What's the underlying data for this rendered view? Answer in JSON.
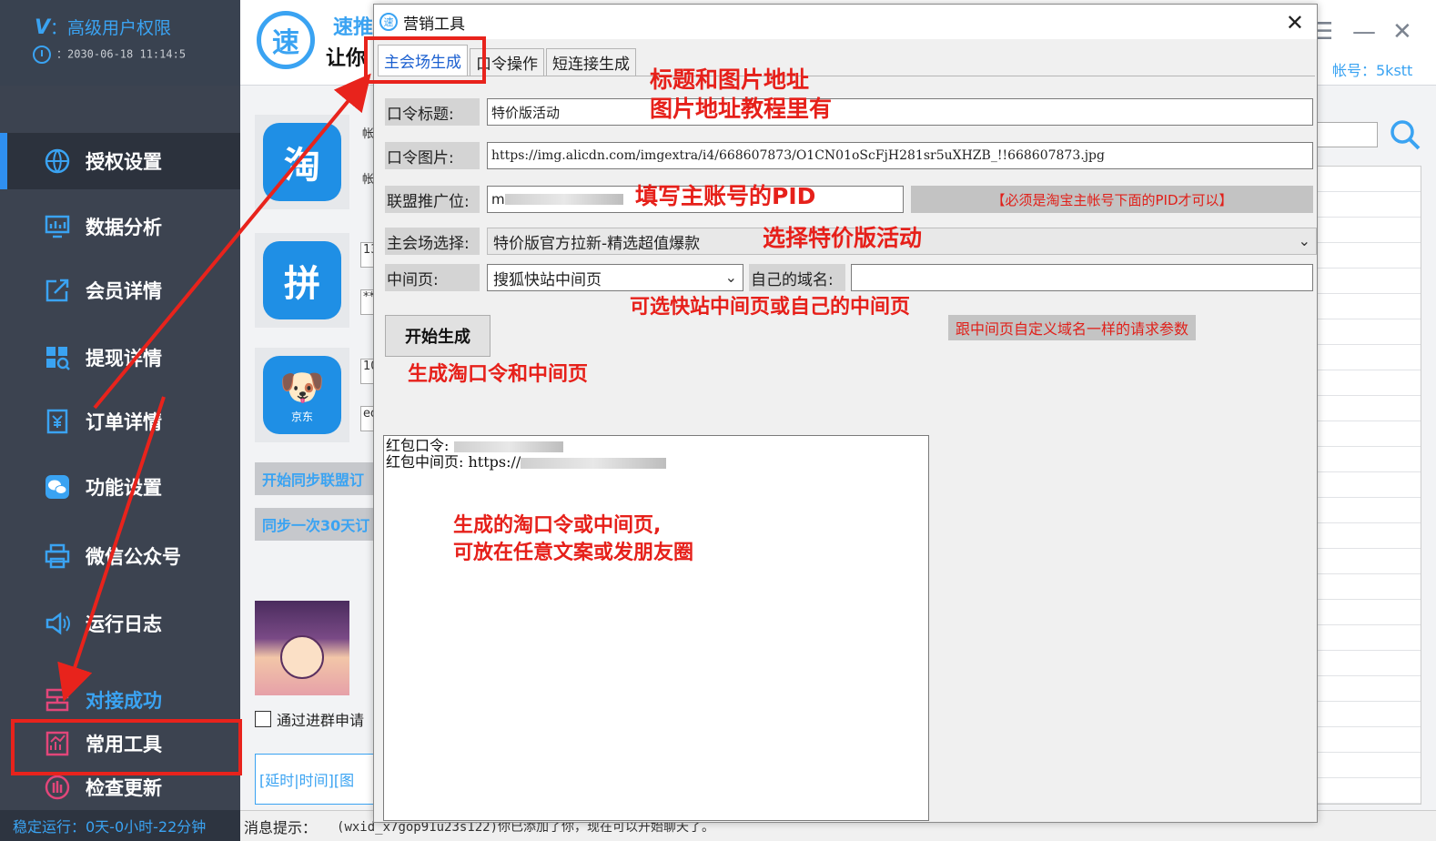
{
  "sidebar": {
    "vip_logo": "V",
    "vip_text": "：高级用户权限",
    "datetime": "：2030-06-18 11:14:5",
    "items": [
      {
        "label": "授权设置"
      },
      {
        "label": "数据分析"
      },
      {
        "label": "会员详情"
      },
      {
        "label": "提现详情"
      },
      {
        "label": "订单详情"
      },
      {
        "label": "功能设置"
      },
      {
        "label": "微信公众号"
      },
      {
        "label": "运行日志"
      },
      {
        "label": "对接成功"
      },
      {
        "label": "常用工具"
      },
      {
        "label": "检查更新"
      }
    ],
    "uptime": "稳定运行：0天-0小时-22分钟"
  },
  "main": {
    "logo_char": "速",
    "app_name": "速推",
    "slogan": "让你",
    "account": "帐号：5kstt",
    "platforms": [
      {
        "name": "淘",
        "sub": ""
      },
      {
        "name": "拼",
        "sub": ""
      },
      {
        "name": "🐶",
        "sub": "京东"
      }
    ],
    "stub_fields": [
      "帐",
      "帐",
      "13",
      "**",
      "10",
      "ed"
    ],
    "sync_btn": "开始同步联盟订",
    "sync30_btn": "同步一次30天订",
    "group_check": "通过进群申请",
    "delay_box": "[延时|时间][图",
    "msg_label": "消息提示：",
    "msg_value": "(wxid_x7gop91u23s122)你已添加了你，现在可以开始聊天了。"
  },
  "dialog": {
    "title": "营销工具",
    "tabs": [
      "主会场生成",
      "口令操作",
      "短连接生成"
    ],
    "fields": {
      "title_label": "口令标题:",
      "title_value": "特价版活动",
      "image_label": "口令图片:",
      "image_value": "https://img.alicdn.com/imgextra/i4/668607873/O1CN01oScFjH281sr5uXHZB_!!668607873.jpg",
      "pid_label": "联盟推广位:",
      "pid_value": "m",
      "pid_note": "【必须是淘宝主帐号下面的PID才可以】",
      "venue_label": "主会场选择:",
      "venue_value": "特价版官方拉新-精选超值爆款",
      "middle_label": "中间页:",
      "middle_value": "搜狐快站中间页",
      "domain_label": "自己的域名:",
      "domain_value": ""
    },
    "generate_button": "开始生成",
    "output_line1": "红包口令:",
    "output_line2": "红包中间页: https://"
  },
  "annotations": {
    "title_image": "标题和图片地址",
    "image_tutorial": "图片地址教程里有",
    "pid": "填写主账号的PID",
    "venue": "选择特价版活动",
    "middle": "可选快站中间页或自己的中间页",
    "param_note": "跟中间页自定义域名一样的请求参数",
    "generate": "生成淘口令和中间页",
    "result1": "生成的淘口令或中间页,",
    "result2": "可放在任意文案或发朋友圈"
  },
  "colors": {
    "accent": "#3aa3f2",
    "sidebar_bg": "#3c4350",
    "annotation_red": "#e6201a"
  }
}
